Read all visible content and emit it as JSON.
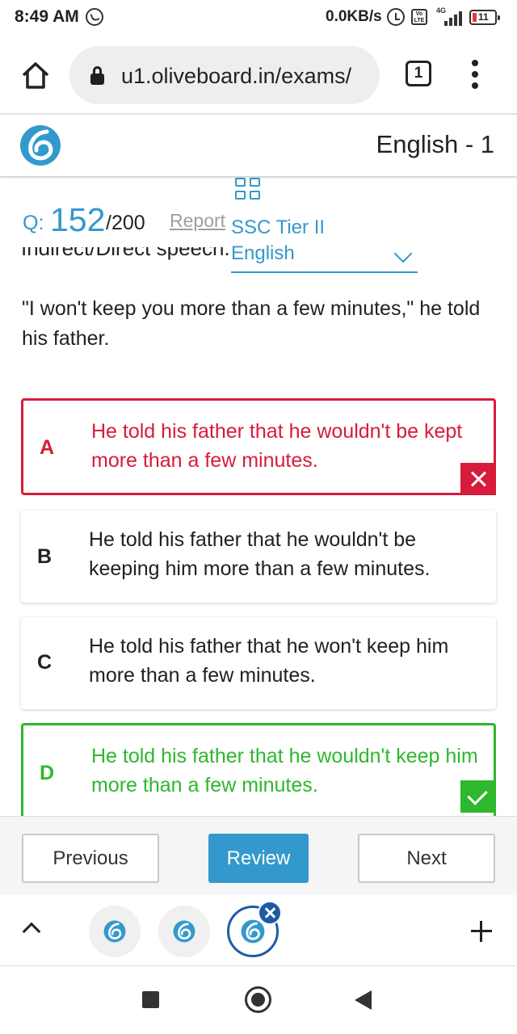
{
  "status_bar": {
    "time": "8:49 AM",
    "net_speed": "0.0KB/s",
    "network_type": "4G",
    "volte": "Vo LTE",
    "battery_level": "11",
    "icons": [
      "whatsapp-icon",
      "alarm-icon",
      "volte-icon",
      "signal-icon",
      "battery-icon"
    ]
  },
  "browser": {
    "url": "u1.oliveboard.in/exams/",
    "tab_count": "1",
    "icons": [
      "home-icon",
      "lock-icon",
      "tabs-icon",
      "menu-icon"
    ]
  },
  "header": {
    "title": "English - 1",
    "brand_color": "#3399cc"
  },
  "question": {
    "label": "Q:",
    "current": "152",
    "total": "/200",
    "report_label": "Report",
    "section": "SSC Tier II English",
    "instruction_partial": "Indirect/Direct speech.",
    "text": "\"I won't keep you more than a few minutes,\" he told his father."
  },
  "options": [
    {
      "letter": "A",
      "text": "He told his father that he wouldn't be kept more than a few minutes.",
      "state": "wrong"
    },
    {
      "letter": "B",
      "text": "He told his father that he wouldn't be keeping him more than a few minutes.",
      "state": "plain"
    },
    {
      "letter": "C",
      "text": "He told his father that he won't keep him more than a few minutes.",
      "state": "plain"
    },
    {
      "letter": "D",
      "text": "He told his father that he wouldn't keep him more than a few minutes.",
      "state": "correct"
    }
  ],
  "colors": {
    "accent": "#3399cc",
    "wrong": "#d81b3a",
    "correct": "#2db82d",
    "bubble_active": "#1f5aa6"
  },
  "actions": {
    "previous_label": "Previous",
    "review_label": "Review",
    "next_label": "Next"
  }
}
